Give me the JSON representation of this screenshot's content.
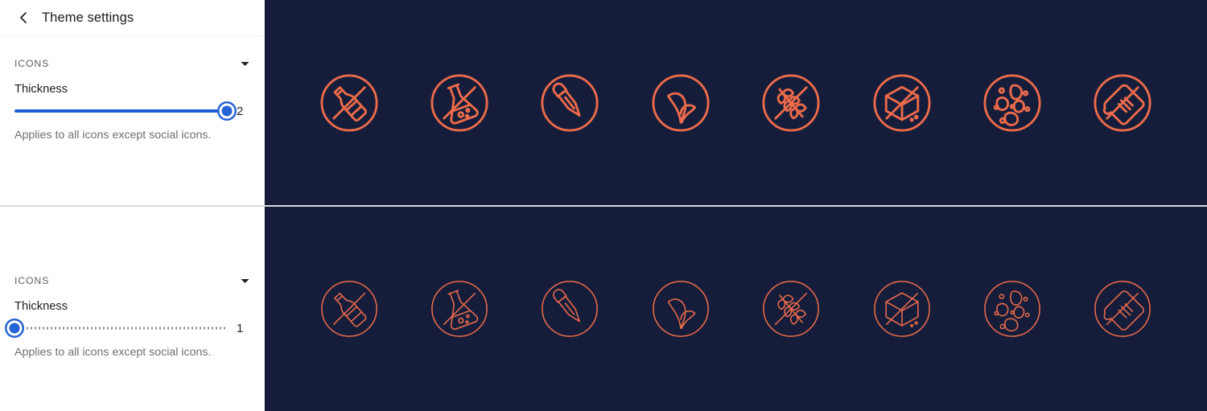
{
  "header": {
    "back_icon": "chevron-left-icon",
    "title": "Theme settings"
  },
  "colors": {
    "accent_slider": "#1f5ed8",
    "preview_background": "#151d3b",
    "icon_stroke": "#ed6b4a",
    "sidebar_background": "#ffffff",
    "divider": "#d8dade"
  },
  "panels": [
    {
      "id": "preview-thickness-2",
      "section": {
        "label": "ICONS",
        "caret_icon": "chevron-down-icon"
      },
      "slider": {
        "label": "Thickness",
        "value": "2",
        "value_number": 2,
        "min": 1,
        "max": 2,
        "fill_percent": 100,
        "track_style": "filled",
        "help_text": "Applies to all icons except social icons."
      },
      "icons": [
        {
          "name": "no-alcohol-icon",
          "stroke_width": 2.6,
          "crossed": true
        },
        {
          "name": "no-chemicals-flask-icon",
          "stroke_width": 2.6,
          "crossed": true
        },
        {
          "name": "no-dropper-icon",
          "stroke_width": 2.6,
          "crossed": true
        },
        {
          "name": "plant-based-leaves-icon",
          "stroke_width": 2.6,
          "crossed": false
        },
        {
          "name": "no-gluten-wheat-icon",
          "stroke_width": 2.6,
          "crossed": true
        },
        {
          "name": "no-sugar-cube-icon",
          "stroke_width": 2.6,
          "crossed": true
        },
        {
          "name": "probiotics-bacteria-icon",
          "stroke_width": 2.6,
          "crossed": false
        },
        {
          "name": "no-bread-slice-icon",
          "stroke_width": 2.6,
          "crossed": true
        }
      ]
    },
    {
      "id": "preview-thickness-1",
      "section": {
        "label": "ICONS",
        "caret_icon": "chevron-down-icon"
      },
      "slider": {
        "label": "Thickness",
        "value": "1",
        "value_number": 1,
        "min": 1,
        "max": 2,
        "fill_percent": 0,
        "track_style": "dotted",
        "help_text": "Applies to all icons except social icons."
      },
      "icons": [
        {
          "name": "no-alcohol-icon",
          "stroke_width": 1.4,
          "crossed": true
        },
        {
          "name": "no-chemicals-flask-icon",
          "stroke_width": 1.4,
          "crossed": true
        },
        {
          "name": "no-dropper-icon",
          "stroke_width": 1.4,
          "crossed": true
        },
        {
          "name": "plant-based-leaves-icon",
          "stroke_width": 1.4,
          "crossed": false
        },
        {
          "name": "no-gluten-wheat-icon",
          "stroke_width": 1.4,
          "crossed": true
        },
        {
          "name": "no-sugar-cube-icon",
          "stroke_width": 1.4,
          "crossed": true
        },
        {
          "name": "probiotics-bacteria-icon",
          "stroke_width": 1.4,
          "crossed": false
        },
        {
          "name": "no-bread-slice-icon",
          "stroke_width": 1.4,
          "crossed": true
        }
      ]
    }
  ]
}
